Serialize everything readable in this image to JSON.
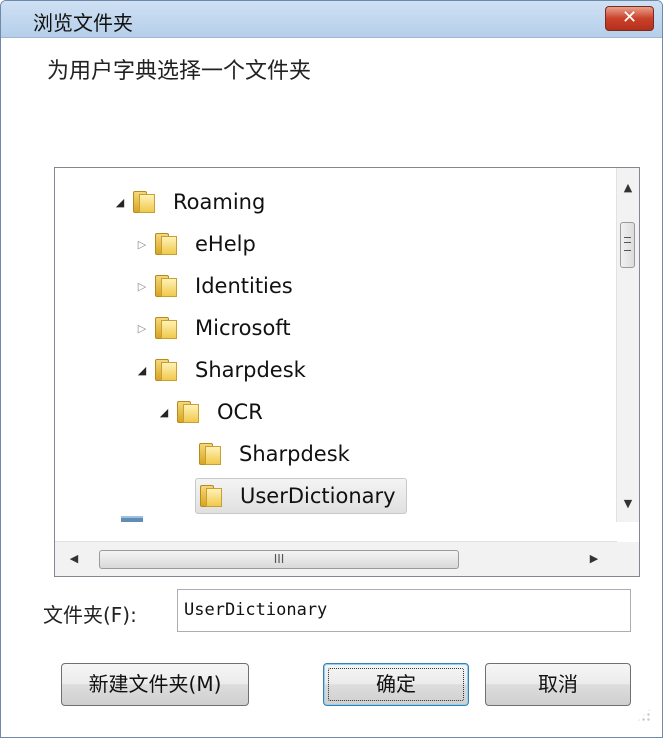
{
  "window": {
    "title": "浏览文件夹",
    "close_label": "✕"
  },
  "instruction": "为用户字典选择一个文件夹",
  "tree": {
    "nodes": [
      {
        "label": "Roaming",
        "expanded": "open"
      },
      {
        "label": "eHelp",
        "expanded": "closed"
      },
      {
        "label": "Identities",
        "expanded": "closed"
      },
      {
        "label": "Microsoft",
        "expanded": "closed"
      },
      {
        "label": "Sharpdesk",
        "expanded": "open"
      },
      {
        "label": "OCR",
        "expanded": "open"
      },
      {
        "label": "Sharpdesk",
        "expanded": "none"
      },
      {
        "label": "UserDictionary",
        "expanded": "none",
        "selected": true
      }
    ],
    "hscroll_thumb_glyph": "III"
  },
  "folder_field": {
    "label": "文件夹(F):",
    "value": "UserDictionary"
  },
  "buttons": {
    "new_folder": "新建文件夹(M)",
    "ok": "确定",
    "cancel": "取消"
  }
}
